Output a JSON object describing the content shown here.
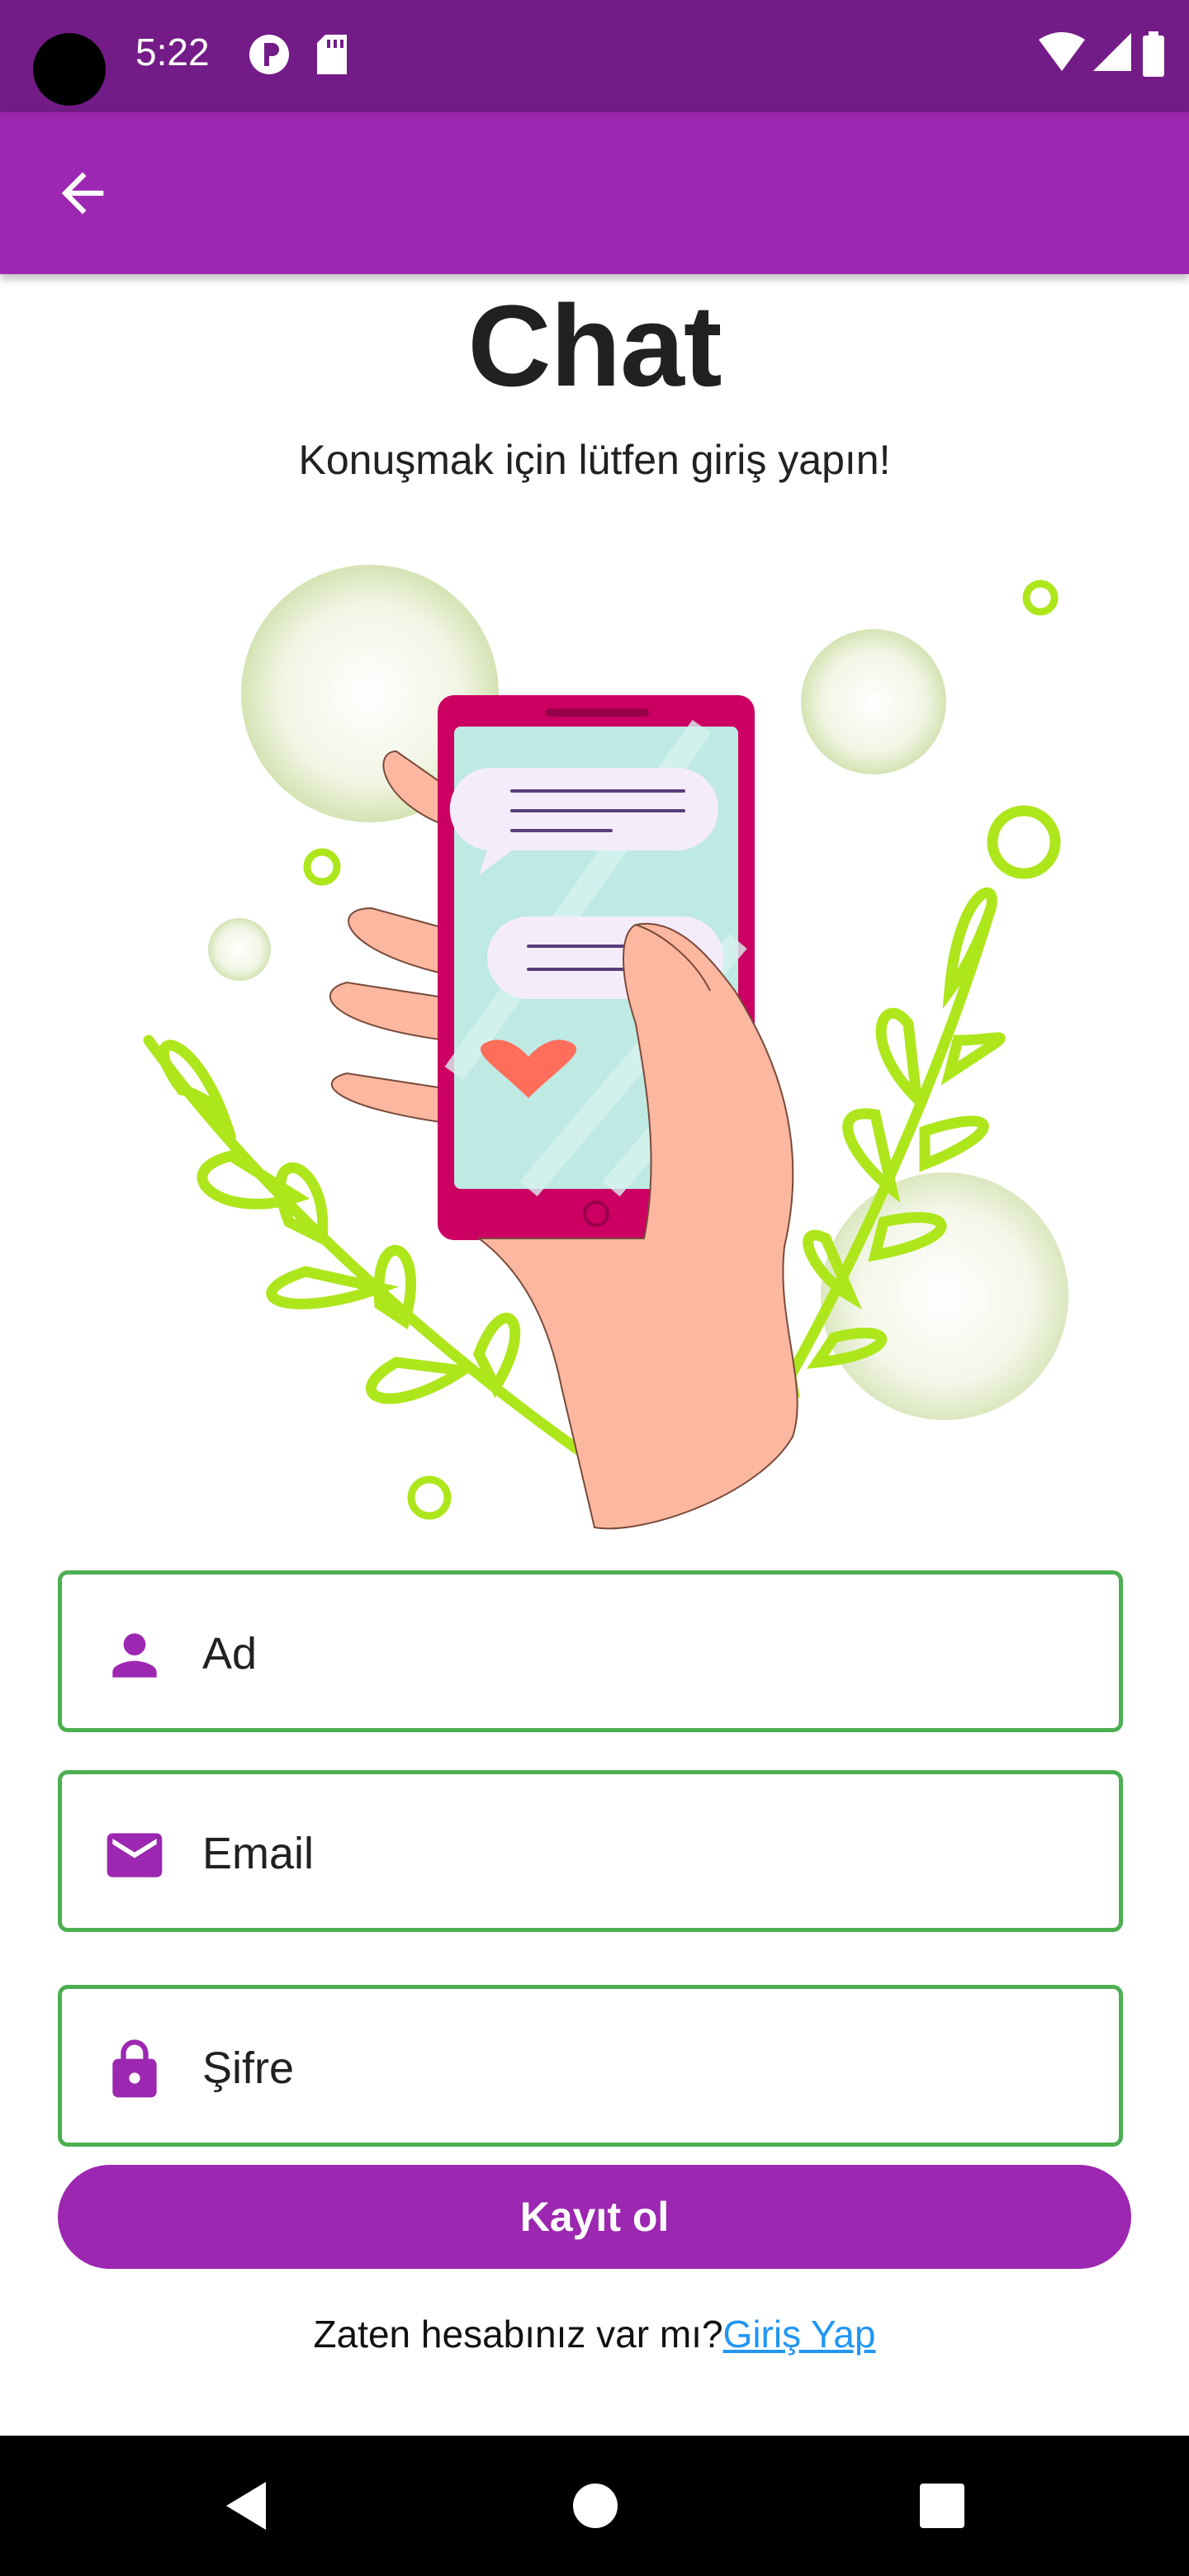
{
  "status_bar": {
    "time": "5:22",
    "icons": [
      "camera-cutout",
      "data-saver-icon",
      "sd-card-icon",
      "wifi-icon",
      "signal-icon",
      "battery-icon"
    ]
  },
  "app_bar": {
    "back_icon": "arrow-back-icon",
    "color": "#9c27b0"
  },
  "header": {
    "title": "Chat",
    "subtitle": "Konuşmak için lütfen giriş yapın!"
  },
  "form": {
    "name_placeholder": "Ad",
    "email_placeholder": "Email",
    "password_placeholder": "Şifre",
    "field_border_color": "#4caf50",
    "icon_color": "#9c27b0",
    "submit_label": "Kayıt ol"
  },
  "footer": {
    "question": "Zaten hesabınız var mı?",
    "login_link": "Giriş Yap",
    "link_color": "#2196f3"
  },
  "nav_bar": {
    "icons": [
      "back-triangle-icon",
      "home-circle-icon",
      "recents-square-icon"
    ]
  }
}
